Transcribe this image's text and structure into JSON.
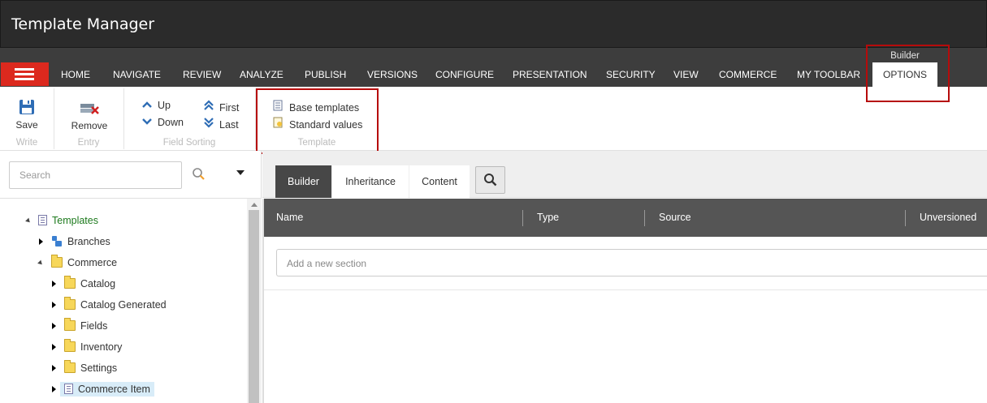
{
  "window": {
    "title": "Template Manager"
  },
  "nav": {
    "tabs": [
      {
        "label": "HOME"
      },
      {
        "label": "NAVIGATE"
      },
      {
        "label": "REVIEW"
      },
      {
        "label": "ANALYZE"
      },
      {
        "label": "PUBLISH"
      },
      {
        "label": "VERSIONS"
      },
      {
        "label": "CONFIGURE"
      },
      {
        "label": "PRESENTATION"
      },
      {
        "label": "SECURITY"
      },
      {
        "label": "VIEW"
      },
      {
        "label": "COMMERCE"
      },
      {
        "label": "MY TOOLBAR"
      },
      {
        "label": "OPTIONS"
      }
    ],
    "active_tab": "OPTIONS",
    "contextual_group": "Builder"
  },
  "ribbon": {
    "write": {
      "save": "Save",
      "group": "Write"
    },
    "entry": {
      "remove": "Remove",
      "group": "Entry"
    },
    "field_sorting": {
      "up": "Up",
      "down": "Down",
      "first": "First",
      "last": "Last",
      "group": "Field Sorting"
    },
    "template": {
      "base_templates": "Base templates",
      "standard_values": "Standard values",
      "group": "Template"
    }
  },
  "search": {
    "placeholder": "Search"
  },
  "tree": {
    "root": "Templates",
    "branches": "Branches",
    "commerce": "Commerce",
    "children": [
      "Catalog",
      "Catalog Generated",
      "Fields",
      "Inventory",
      "Settings",
      "Commerce Item"
    ],
    "selected": "Commerce Item"
  },
  "content_tabs": [
    "Builder",
    "Inheritance",
    "Content"
  ],
  "grid": {
    "columns": [
      "Name",
      "Type",
      "Source",
      "Unversioned"
    ],
    "add_section_placeholder": "Add a new section"
  },
  "colors": {
    "accent_red": "#dc291e",
    "highlight_red": "#b60b0b",
    "titlebar": "#2b2b2b",
    "navbar": "#3d3d3d"
  }
}
